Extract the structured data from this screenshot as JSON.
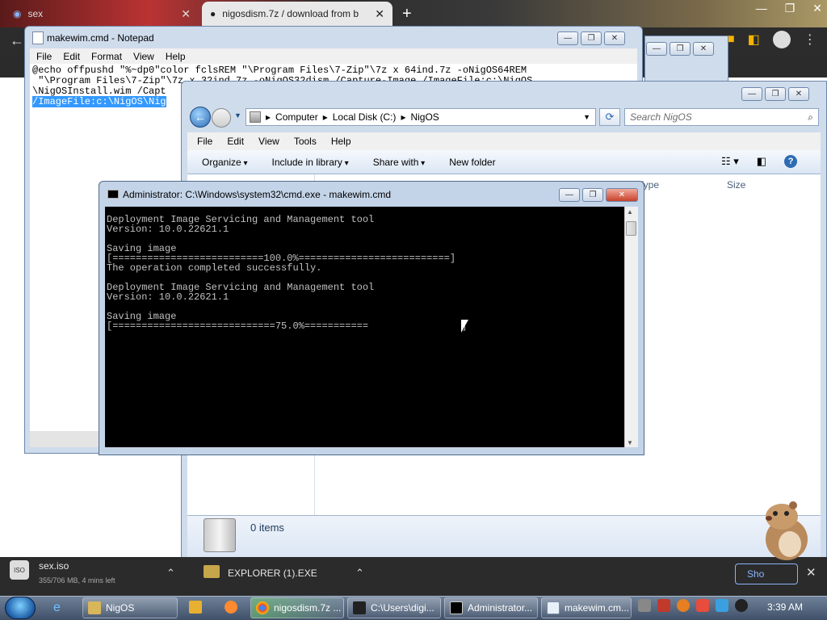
{
  "browser": {
    "tab1": {
      "title": "sex"
    },
    "tab2": {
      "title": "nigosdism.7z / download from b"
    }
  },
  "notepad": {
    "title": "makewim.cmd - Notepad",
    "menu": [
      "File",
      "Edit",
      "Format",
      "View",
      "Help"
    ],
    "lines": [
      "@echo offpushd \"%~dp0\"color fclsREM \"\\Program Files\\7-Zip\"\\7z x 64ind.7z -oNigOS64REM",
      " \"\\Program Files\\7-Zip\"\\7z x 32ind.7z -oNigOS32dism /Capture-Image /ImageFile:c:\\NigOS",
      "\\NigOSInstall.wim /Capt",
      "/ImageFile:c:\\NigOS\\Nig"
    ]
  },
  "explorer": {
    "path": [
      "Computer",
      "Local Disk (C:)",
      "NigOS"
    ],
    "search_placeholder": "Search NigOS",
    "menu": [
      "File",
      "Edit",
      "View",
      "Tools",
      "Help"
    ],
    "commands": {
      "organize": "Organize",
      "include": "Include in library",
      "share": "Share with",
      "newfolder": "New folder"
    },
    "columns": {
      "type": "Type",
      "size": "Size"
    },
    "status": "0 items"
  },
  "cmd": {
    "title": "Administrator: C:\\Windows\\system32\\cmd.exe - makewim.cmd",
    "output": "Deployment Image Servicing and Management tool\nVersion: 10.0.22621.1\n\nSaving image\n[==========================100.0%==========================]\nThe operation completed successfully.\n\nDeployment Image Servicing and Management tool\nVersion: 10.0.22621.1\n\nSaving image\n[============================75.0%===========                ]",
    "progress_percent": 75.0
  },
  "downloads": {
    "item1": {
      "name": "sex.iso",
      "status": "355/706 MB, 4 mins left"
    },
    "item2": {
      "name": "EXPLORER (1).EXE"
    },
    "show_all": "Sho"
  },
  "taskbar": {
    "items": [
      "NigOS",
      "nigosdism.7z ...",
      "C:\\Users\\digi...",
      "Administrator...",
      "makewim.cm..."
    ],
    "clock": "3:39 AM"
  },
  "colors": {
    "cmd_bg": "#000000",
    "cmd_text": "#c0c0c0",
    "selection": "#3399ff"
  }
}
